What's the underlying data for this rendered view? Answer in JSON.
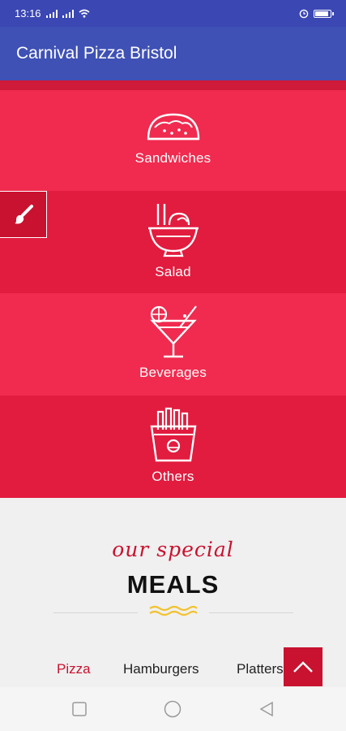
{
  "status_bar": {
    "time": "13:16"
  },
  "app_bar": {
    "title": "Carnival Pizza Bristol"
  },
  "categories": [
    {
      "label": "Sandwiches",
      "icon": "taco-icon",
      "color": "#f02b4f"
    },
    {
      "label": "Salad",
      "icon": "salad-bowl-icon",
      "color": "#e21c3f"
    },
    {
      "label": "Beverages",
      "icon": "cocktail-icon",
      "color": "#f02b4f"
    },
    {
      "label": "Others",
      "icon": "fries-icon",
      "color": "#e21c3f"
    }
  ],
  "special": {
    "script_title": "our special",
    "heading": "MEALS",
    "accent_color": "#c8122f",
    "wave_color": "#f2c230"
  },
  "tabs": [
    {
      "label": "Pizza",
      "active": true
    },
    {
      "label": "Hamburgers",
      "active": false
    },
    {
      "label": "Platters",
      "active": false
    }
  ]
}
